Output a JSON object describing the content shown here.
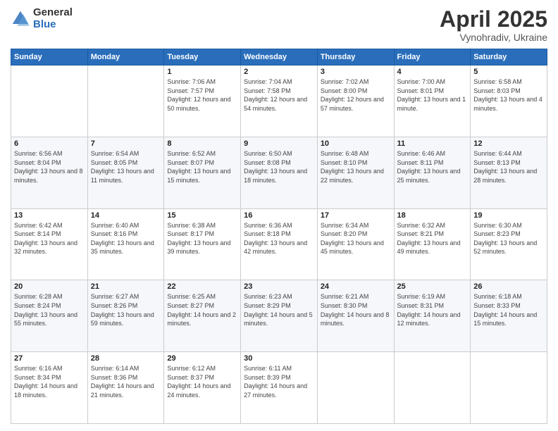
{
  "header": {
    "logo_general": "General",
    "logo_blue": "Blue",
    "month_title": "April 2025",
    "location": "Vynohradiv, Ukraine"
  },
  "weekdays": [
    "Sunday",
    "Monday",
    "Tuesday",
    "Wednesday",
    "Thursday",
    "Friday",
    "Saturday"
  ],
  "weeks": [
    [
      {
        "day": "",
        "info": ""
      },
      {
        "day": "",
        "info": ""
      },
      {
        "day": "1",
        "info": "Sunrise: 7:06 AM\nSunset: 7:57 PM\nDaylight: 12 hours and 50 minutes."
      },
      {
        "day": "2",
        "info": "Sunrise: 7:04 AM\nSunset: 7:58 PM\nDaylight: 12 hours and 54 minutes."
      },
      {
        "day": "3",
        "info": "Sunrise: 7:02 AM\nSunset: 8:00 PM\nDaylight: 12 hours and 57 minutes."
      },
      {
        "day": "4",
        "info": "Sunrise: 7:00 AM\nSunset: 8:01 PM\nDaylight: 13 hours and 1 minute."
      },
      {
        "day": "5",
        "info": "Sunrise: 6:58 AM\nSunset: 8:03 PM\nDaylight: 13 hours and 4 minutes."
      }
    ],
    [
      {
        "day": "6",
        "info": "Sunrise: 6:56 AM\nSunset: 8:04 PM\nDaylight: 13 hours and 8 minutes."
      },
      {
        "day": "7",
        "info": "Sunrise: 6:54 AM\nSunset: 8:05 PM\nDaylight: 13 hours and 11 minutes."
      },
      {
        "day": "8",
        "info": "Sunrise: 6:52 AM\nSunset: 8:07 PM\nDaylight: 13 hours and 15 minutes."
      },
      {
        "day": "9",
        "info": "Sunrise: 6:50 AM\nSunset: 8:08 PM\nDaylight: 13 hours and 18 minutes."
      },
      {
        "day": "10",
        "info": "Sunrise: 6:48 AM\nSunset: 8:10 PM\nDaylight: 13 hours and 22 minutes."
      },
      {
        "day": "11",
        "info": "Sunrise: 6:46 AM\nSunset: 8:11 PM\nDaylight: 13 hours and 25 minutes."
      },
      {
        "day": "12",
        "info": "Sunrise: 6:44 AM\nSunset: 8:13 PM\nDaylight: 13 hours and 28 minutes."
      }
    ],
    [
      {
        "day": "13",
        "info": "Sunrise: 6:42 AM\nSunset: 8:14 PM\nDaylight: 13 hours and 32 minutes."
      },
      {
        "day": "14",
        "info": "Sunrise: 6:40 AM\nSunset: 8:16 PM\nDaylight: 13 hours and 35 minutes."
      },
      {
        "day": "15",
        "info": "Sunrise: 6:38 AM\nSunset: 8:17 PM\nDaylight: 13 hours and 39 minutes."
      },
      {
        "day": "16",
        "info": "Sunrise: 6:36 AM\nSunset: 8:18 PM\nDaylight: 13 hours and 42 minutes."
      },
      {
        "day": "17",
        "info": "Sunrise: 6:34 AM\nSunset: 8:20 PM\nDaylight: 13 hours and 45 minutes."
      },
      {
        "day": "18",
        "info": "Sunrise: 6:32 AM\nSunset: 8:21 PM\nDaylight: 13 hours and 49 minutes."
      },
      {
        "day": "19",
        "info": "Sunrise: 6:30 AM\nSunset: 8:23 PM\nDaylight: 13 hours and 52 minutes."
      }
    ],
    [
      {
        "day": "20",
        "info": "Sunrise: 6:28 AM\nSunset: 8:24 PM\nDaylight: 13 hours and 55 minutes."
      },
      {
        "day": "21",
        "info": "Sunrise: 6:27 AM\nSunset: 8:26 PM\nDaylight: 13 hours and 59 minutes."
      },
      {
        "day": "22",
        "info": "Sunrise: 6:25 AM\nSunset: 8:27 PM\nDaylight: 14 hours and 2 minutes."
      },
      {
        "day": "23",
        "info": "Sunrise: 6:23 AM\nSunset: 8:29 PM\nDaylight: 14 hours and 5 minutes."
      },
      {
        "day": "24",
        "info": "Sunrise: 6:21 AM\nSunset: 8:30 PM\nDaylight: 14 hours and 8 minutes."
      },
      {
        "day": "25",
        "info": "Sunrise: 6:19 AM\nSunset: 8:31 PM\nDaylight: 14 hours and 12 minutes."
      },
      {
        "day": "26",
        "info": "Sunrise: 6:18 AM\nSunset: 8:33 PM\nDaylight: 14 hours and 15 minutes."
      }
    ],
    [
      {
        "day": "27",
        "info": "Sunrise: 6:16 AM\nSunset: 8:34 PM\nDaylight: 14 hours and 18 minutes."
      },
      {
        "day": "28",
        "info": "Sunrise: 6:14 AM\nSunset: 8:36 PM\nDaylight: 14 hours and 21 minutes."
      },
      {
        "day": "29",
        "info": "Sunrise: 6:12 AM\nSunset: 8:37 PM\nDaylight: 14 hours and 24 minutes."
      },
      {
        "day": "30",
        "info": "Sunrise: 6:11 AM\nSunset: 8:39 PM\nDaylight: 14 hours and 27 minutes."
      },
      {
        "day": "",
        "info": ""
      },
      {
        "day": "",
        "info": ""
      },
      {
        "day": "",
        "info": ""
      }
    ]
  ]
}
